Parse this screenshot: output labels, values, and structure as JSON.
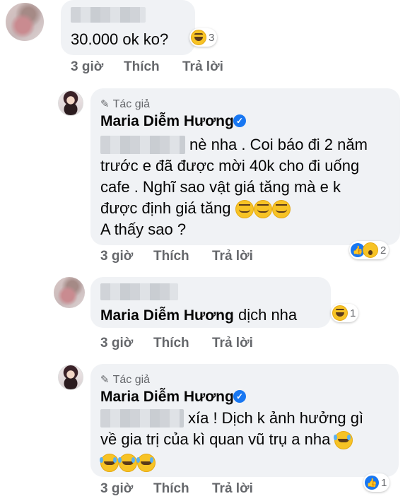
{
  "comments": [
    {
      "text": "30.000 ok ko?",
      "reaction_count": "3",
      "actions": {
        "time": "3 giờ",
        "like": "Thích",
        "reply": "Trả lời"
      }
    },
    {
      "author_badge": "Tác giả",
      "name": "Maria Diễm Hương",
      "lines": [
        "nè nha . Coi báo đi 2 năm",
        "trước e đã được mời 40k cho đi uống",
        "cafe . Nghĩ sao vật giá tăng mà e k",
        "được định giá tăng",
        "A thấy sao ?"
      ],
      "reaction_count": "2",
      "actions": {
        "time": "3 giờ",
        "like": "Thích",
        "reply": "Trả lời"
      }
    },
    {
      "name": "Maria Diễm Hương",
      "text": "dịch nha",
      "reaction_count": "1",
      "actions": {
        "time": "3 giờ",
        "like": "Thích",
        "reply": "Trả lời"
      }
    },
    {
      "author_badge": "Tác giả",
      "name": "Maria Diễm Hương",
      "lines": [
        "xía ! Dịch k ảnh hưởng gì",
        "về gia trị của kì quan vũ trụ a nha"
      ],
      "reaction_count": "1",
      "actions": {
        "time": "3 giờ",
        "like": "Thích",
        "reply": "Trả lời"
      }
    }
  ],
  "icons": {
    "verified": "verified-badge-icon",
    "pencil": "pencil-icon",
    "like": "like-icon",
    "haha": "haha-emoji-icon",
    "wow": "wow-emoji-icon",
    "smirk": "smirk-emoji-icon"
  },
  "colors": {
    "bubble": "#f0f2f5",
    "verified": "#1877f2",
    "meta": "#65676b"
  }
}
